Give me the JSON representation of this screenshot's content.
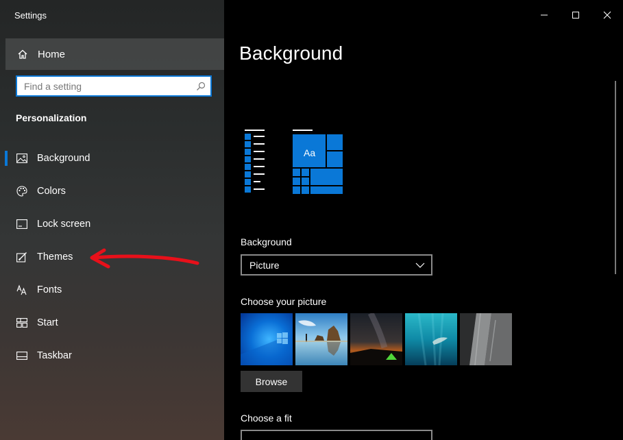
{
  "window": {
    "title": "Settings",
    "controls": [
      "minimize-icon",
      "maximize-icon",
      "close-icon"
    ]
  },
  "sidebar": {
    "home_label": "Home",
    "search_placeholder": "Find a setting",
    "section_title": "Personalization",
    "items": [
      {
        "label": "Background",
        "icon": "picture-icon",
        "active": true
      },
      {
        "label": "Colors",
        "icon": "palette-icon",
        "active": false
      },
      {
        "label": "Lock screen",
        "icon": "lock-screen-icon",
        "active": false
      },
      {
        "label": "Themes",
        "icon": "themes-icon",
        "active": false
      },
      {
        "label": "Fonts",
        "icon": "fonts-icon",
        "active": false
      },
      {
        "label": "Start",
        "icon": "start-icon",
        "active": false
      },
      {
        "label": "Taskbar",
        "icon": "taskbar-icon",
        "active": false
      }
    ]
  },
  "main": {
    "title": "Background",
    "preview_tile_text": "Aa",
    "background_label": "Background",
    "background_value": "Picture",
    "choose_picture_label": "Choose your picture",
    "pictures": [
      "windows-blue",
      "rock-beach",
      "night-tent",
      "underwater-swimmer",
      "rock-cliff"
    ],
    "browse_label": "Browse",
    "choose_fit_label": "Choose a fit"
  },
  "colors": {
    "accent": "#0a78d7",
    "annotation": "#e8101a"
  }
}
